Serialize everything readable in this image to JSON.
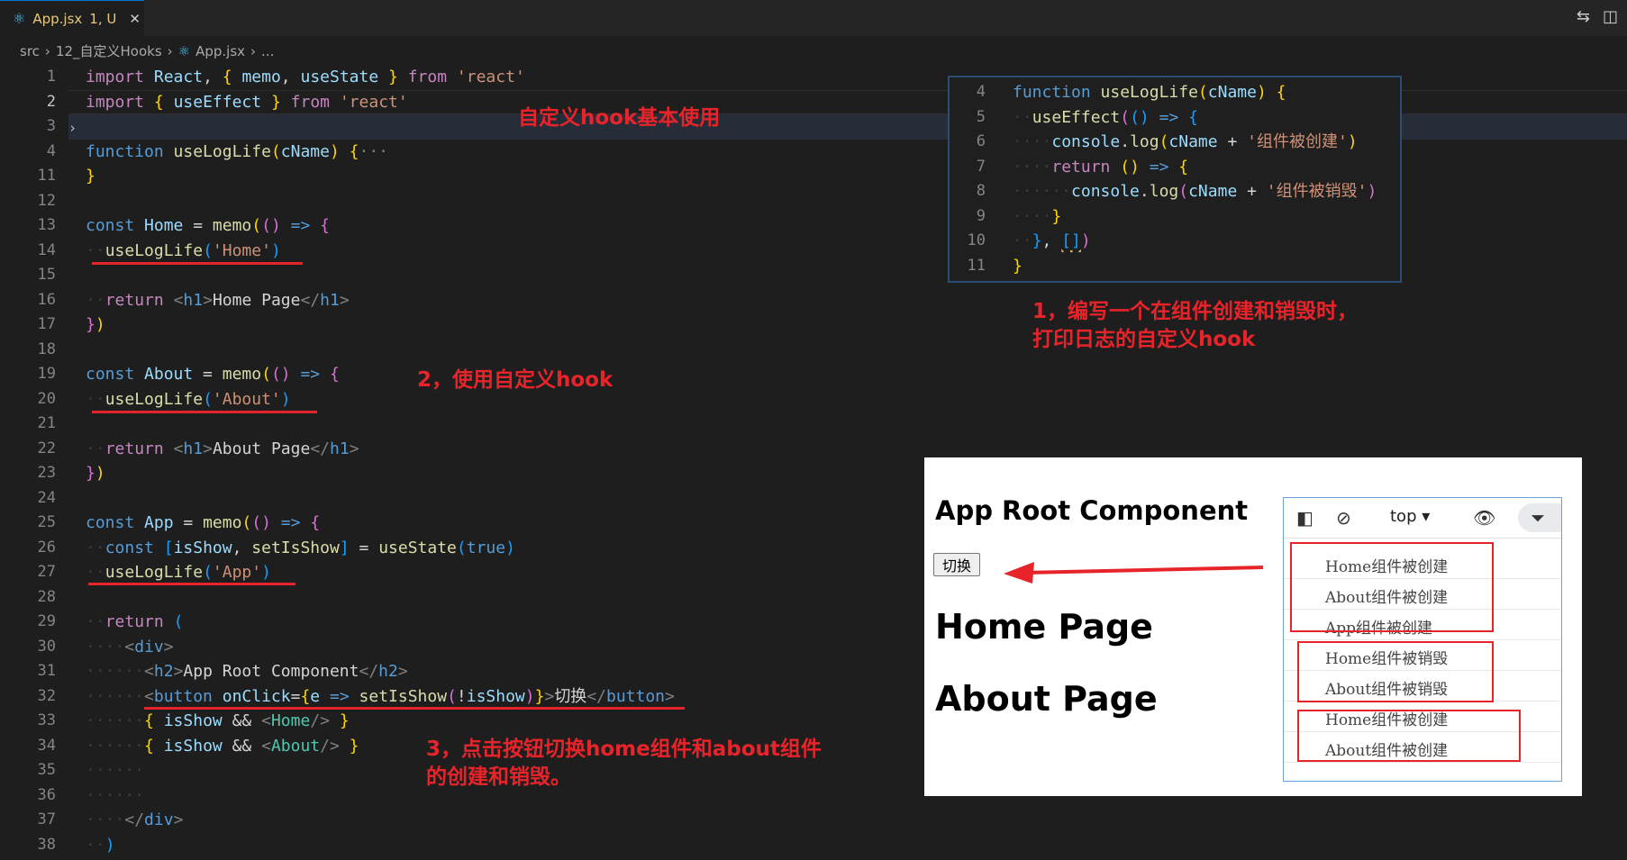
{
  "tab": {
    "filename": "App.jsx",
    "status": "1, U"
  },
  "breadcrumb": {
    "parts": [
      "src",
      "12_自定义Hooks",
      "App.jsx",
      "..."
    ]
  },
  "editor": {
    "line_numbers": [
      "1",
      "2",
      "3",
      "4",
      "11",
      "12",
      "13",
      "14",
      "15",
      "16",
      "17",
      "18",
      "19",
      "20",
      "21",
      "22",
      "23",
      "24",
      "25",
      "26",
      "27",
      "28",
      "29",
      "30",
      "31",
      "32",
      "33",
      "34",
      "35",
      "36",
      "37",
      "38"
    ],
    "active_line": "2"
  },
  "popup": {
    "line_numbers": [
      "4",
      "5",
      "6",
      "7",
      "8",
      "9",
      "10",
      "11"
    ]
  },
  "annotations": {
    "title": "自定义hook基本使用",
    "step1_line1": "1，编写一个在组件创建和销毁时，",
    "step1_line2": "打印日志的自定义hook",
    "step2": "2，使用自定义hook",
    "step3_line1": "3，点击按钮切换home组件和about组件",
    "step3_line2": "的创建和销毁。"
  },
  "browser": {
    "heading": "App Root Component",
    "button_label": "切换",
    "home_heading": "Home Page",
    "about_heading": "About Page"
  },
  "devtools": {
    "context": "top",
    "logs": [
      "Home组件被创建",
      "About组件被创建",
      "App组件被创建",
      "Home组件被销毁",
      "About组件被销毁",
      "Home组件被创建",
      "About组件被创建"
    ]
  },
  "colors": {
    "annotation": "#e8242b",
    "editor_bg": "#1e1e1e"
  }
}
